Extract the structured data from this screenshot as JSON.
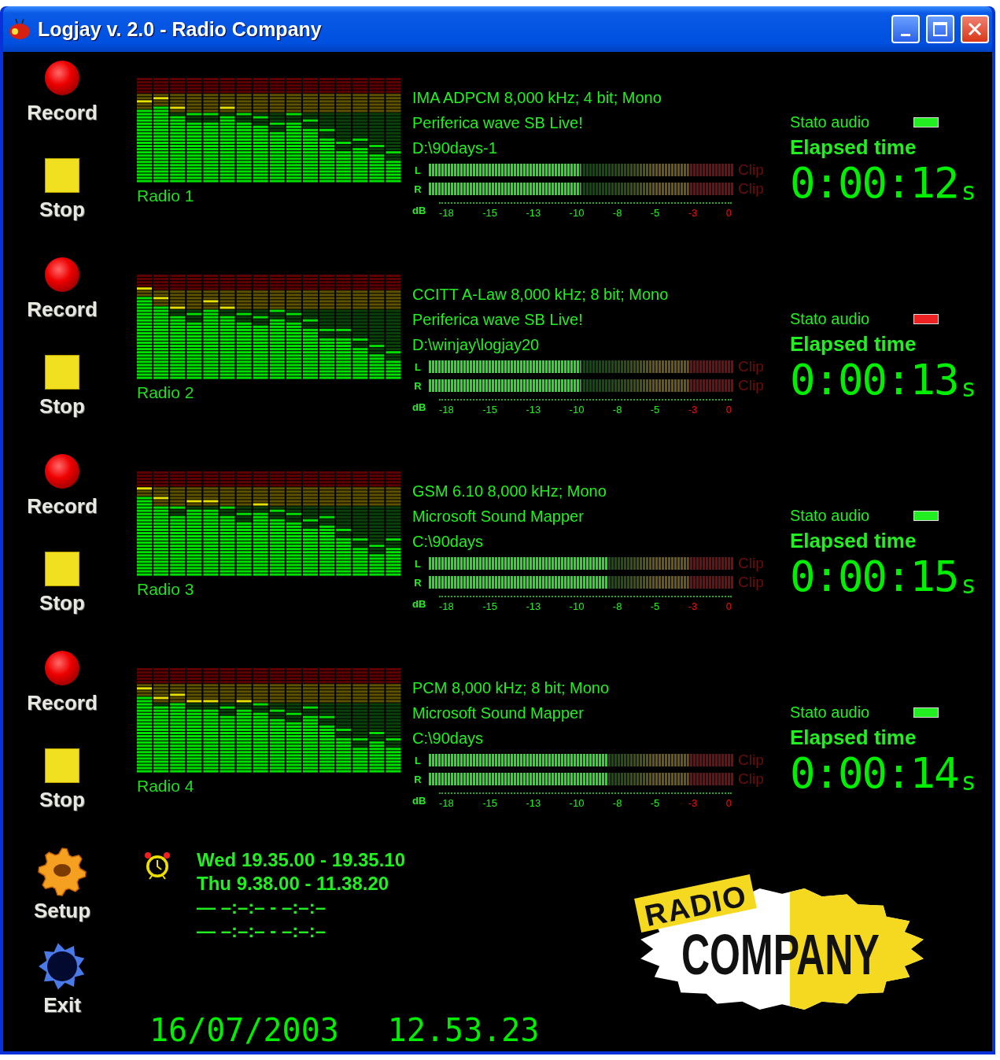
{
  "window": {
    "title": "Logjay v. 2.0 - Radio Company"
  },
  "channels": [
    {
      "record_label": "Record",
      "stop_label": "Stop",
      "name": "Radio 1",
      "format": "IMA ADPCM 8,000 kHz; 4 bit; Mono",
      "device": "Periferica wave SB Live!",
      "path": "D:\\90days-1",
      "meters": [
        {
          "channel": "L",
          "level": 0.5,
          "clip": "Clip"
        },
        {
          "channel": "R",
          "level": 0.5,
          "clip": "Clip"
        }
      ],
      "scale_unit": "dB",
      "scale": [
        {
          "label": "-18",
          "kind": "normal"
        },
        {
          "label": "-15",
          "kind": "normal"
        },
        {
          "label": "-13",
          "kind": "normal"
        },
        {
          "label": "-10",
          "kind": "normal"
        },
        {
          "label": "-8",
          "kind": "normal"
        },
        {
          "label": "-5",
          "kind": "normal"
        },
        {
          "label": "-3",
          "kind": "peak"
        },
        {
          "label": "0",
          "kind": "peak"
        }
      ],
      "status": {
        "label": "Stato audio",
        "color": "#22ee22"
      },
      "elapsed_label": "Elapsed time",
      "elapsed": "0:00:12",
      "elapsed_unit": "s"
    },
    {
      "record_label": "Record",
      "stop_label": "Stop",
      "name": "Radio 2",
      "format": "CCITT A-Law 8,000 kHz; 8 bit; Mono",
      "device": "Periferica wave SB Live!",
      "path": "D:\\winjay\\logjay20",
      "meters": [
        {
          "channel": "L",
          "level": 0.5,
          "clip": "Clip"
        },
        {
          "channel": "R",
          "level": 0.5,
          "clip": "Clip"
        }
      ],
      "scale_unit": "dB",
      "scale": [
        {
          "label": "-18",
          "kind": "normal"
        },
        {
          "label": "-15",
          "kind": "normal"
        },
        {
          "label": "-13",
          "kind": "normal"
        },
        {
          "label": "-10",
          "kind": "normal"
        },
        {
          "label": "-8",
          "kind": "normal"
        },
        {
          "label": "-5",
          "kind": "normal"
        },
        {
          "label": "-3",
          "kind": "peak"
        },
        {
          "label": "0",
          "kind": "peak"
        }
      ],
      "status": {
        "label": "Stato audio",
        "color": "#ee2222"
      },
      "elapsed_label": "Elapsed time",
      "elapsed": "0:00:13",
      "elapsed_unit": "s"
    },
    {
      "record_label": "Record",
      "stop_label": "Stop",
      "name": "Radio 3",
      "format": "GSM 6.10 8,000 kHz; Mono",
      "device": "Microsoft Sound Mapper",
      "path": "C:\\90days",
      "meters": [
        {
          "channel": "L",
          "level": 0.59,
          "clip": "Clip"
        },
        {
          "channel": "R",
          "level": 0.59,
          "clip": "Clip"
        }
      ],
      "scale_unit": "dB",
      "scale": [
        {
          "label": "-18",
          "kind": "normal"
        },
        {
          "label": "-15",
          "kind": "normal"
        },
        {
          "label": "-13",
          "kind": "normal"
        },
        {
          "label": "-10",
          "kind": "normal"
        },
        {
          "label": "-8",
          "kind": "normal"
        },
        {
          "label": "-5",
          "kind": "normal"
        },
        {
          "label": "-3",
          "kind": "peak"
        },
        {
          "label": "0",
          "kind": "peak"
        }
      ],
      "status": {
        "label": "Stato audio",
        "color": "#22ee22"
      },
      "elapsed_label": "Elapsed time",
      "elapsed": "0:00:15",
      "elapsed_unit": "s"
    },
    {
      "record_label": "Record",
      "stop_label": "Stop",
      "name": "Radio 4",
      "format": "PCM 8,000 kHz; 8 bit; Mono",
      "device": "Microsoft Sound Mapper",
      "path": "C:\\90days",
      "meters": [
        {
          "channel": "L",
          "level": 0.59,
          "clip": "Clip"
        },
        {
          "channel": "R",
          "level": 0.59,
          "clip": "Clip"
        }
      ],
      "scale_unit": "dB",
      "scale": [
        {
          "label": "-18",
          "kind": "normal"
        },
        {
          "label": "-15",
          "kind": "normal"
        },
        {
          "label": "-13",
          "kind": "normal"
        },
        {
          "label": "-10",
          "kind": "normal"
        },
        {
          "label": "-8",
          "kind": "normal"
        },
        {
          "label": "-5",
          "kind": "normal"
        },
        {
          "label": "-3",
          "kind": "peak"
        },
        {
          "label": "0",
          "kind": "peak"
        }
      ],
      "status": {
        "label": "Stato audio",
        "color": "#22ee22"
      },
      "elapsed_label": "Elapsed time",
      "elapsed": "0:00:14",
      "elapsed_unit": "s"
    }
  ],
  "tools": [
    {
      "label": "Setup",
      "kind": "setup"
    },
    {
      "label": "Exit",
      "kind": "exit"
    }
  ],
  "schedule": [
    "Wed 19.35.00 - 19.35.10",
    "Thu 9.38.00 - 11.38.20",
    "— –:–:– - –:–:–",
    "— –:–:– - –:–:–"
  ],
  "clock": {
    "date": "16/07/2003",
    "time": "12.53.23"
  },
  "logo": {
    "top": "RADIO",
    "main": "COMPANY"
  }
}
